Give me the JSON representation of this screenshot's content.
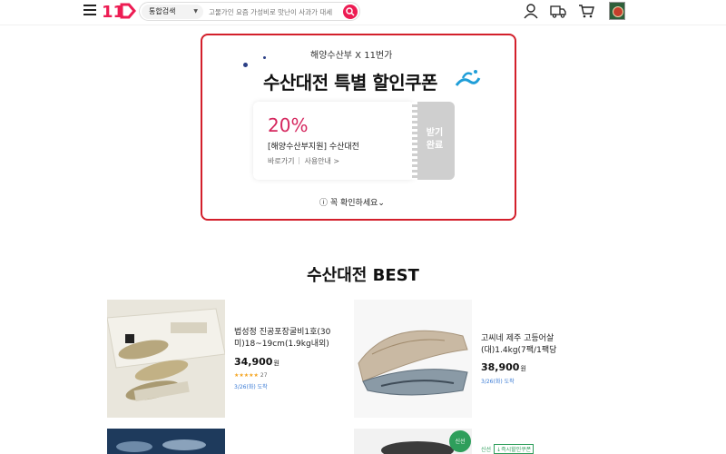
{
  "header": {
    "search_category": "통합검색",
    "search_placeholder": "고물가인 요즘 가성비로 맛난이 사과가 대세"
  },
  "coupon": {
    "subtitle": "해양수산부 X 11번가",
    "title": "수산대전 특별 할인쿠폰",
    "discount": "20%",
    "name": "[해양수산부지원] 수산대전",
    "link_go": "바로가기",
    "link_info": "사용안내 >",
    "stub_line1": "받기",
    "stub_line2": "완료",
    "notice": "ⓘ 꼭 확인하세요⌄"
  },
  "best": {
    "title": "수산대전 BEST",
    "products": [
      {
        "name": "법성정 진공포장굴비1호(30미)18~19cm(1.9kg내외)",
        "price": "34,900",
        "won": "원",
        "stars": "★★★★★",
        "review_count": "27",
        "delivery": "3/26(화) 도착"
      },
      {
        "name": "고씨네 제주 고등어살(대)1.4kg(7팩/1팩당",
        "price": "38,900",
        "won": "원",
        "delivery": "3/26(화) 도착"
      },
      {
        "badge_text": "신선",
        "badge_extra": "↓즉시할인쿠폰"
      }
    ]
  },
  "colors": {
    "brand_red": "#d31f2b",
    "search_pink": "#ed1c53",
    "discount_pink": "#d5275e"
  }
}
